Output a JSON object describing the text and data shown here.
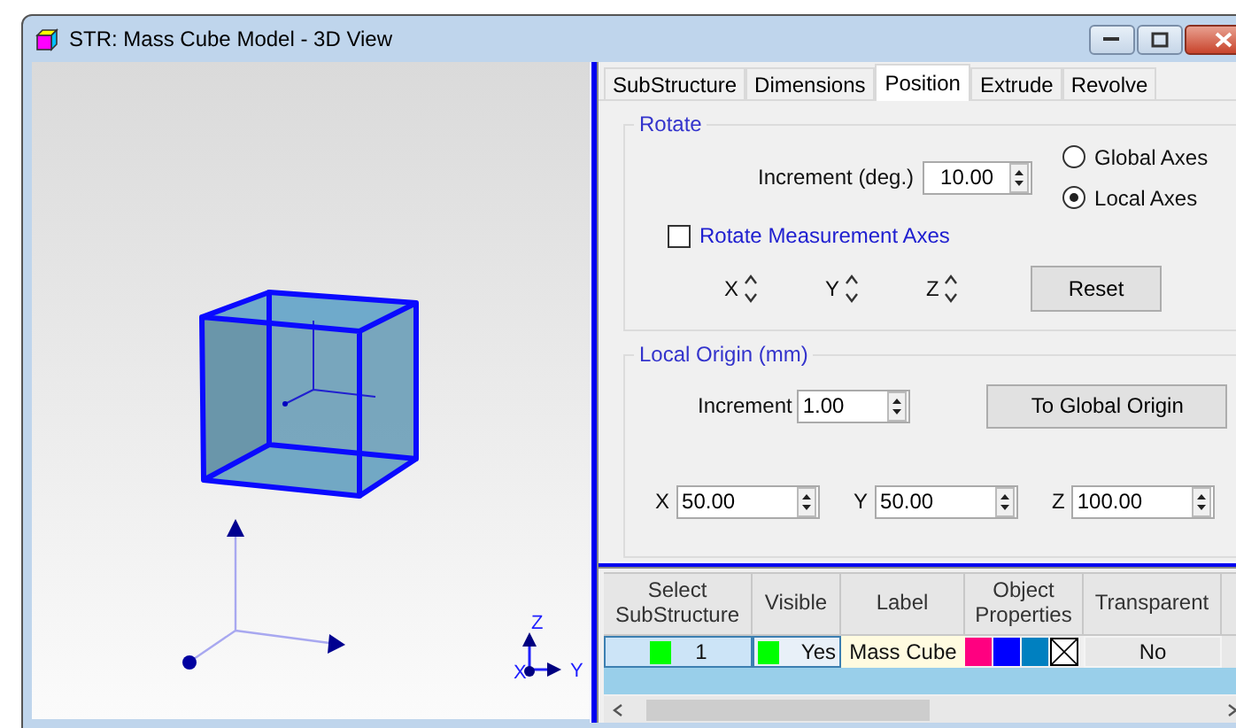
{
  "window": {
    "title": "STR: Mass Cube Model - 3D View"
  },
  "view": {
    "triad_labels": [
      "Z",
      "X",
      "Y"
    ]
  },
  "tabs": [
    {
      "label": "SubStructure",
      "selected": false
    },
    {
      "label": "Dimensions",
      "selected": false
    },
    {
      "label": "Position",
      "selected": true
    },
    {
      "label": "Extrude",
      "selected": false
    },
    {
      "label": "Revolve",
      "selected": false
    }
  ],
  "rotate": {
    "title": "Rotate",
    "increment_label": "Increment (deg.)",
    "increment": "10.00",
    "axes": [
      {
        "label": "Global Axes",
        "selected": false
      },
      {
        "label": "Local Axes",
        "selected": true
      }
    ],
    "measure": {
      "label": "Rotate Measurement Axes",
      "checked": false
    },
    "spinners": [
      "X",
      "Y",
      "Z"
    ],
    "reset": "Reset"
  },
  "origin": {
    "title": "Local Origin (mm)",
    "increment_label": "Increment",
    "increment": "1.00",
    "button": "To Global Origin",
    "coords": [
      {
        "label": "X",
        "value": "50.00"
      },
      {
        "label": "Y",
        "value": "50.00"
      },
      {
        "label": "Z",
        "value": "100.00"
      }
    ]
  },
  "table": {
    "columns": [
      "Select SubStructure",
      "Visible",
      "Label",
      "Object Properties",
      "Transparent"
    ],
    "rows": [
      {
        "select": {
          "value": "1",
          "color": "#00ff00",
          "selected": true
        },
        "visible": {
          "value": "Yes",
          "color": "#00ff00"
        },
        "label": "Mass Cube",
        "properties": [
          {
            "kind": "color",
            "color": "#ff0080"
          },
          {
            "kind": "color",
            "color": "#0000ff"
          },
          {
            "kind": "color",
            "color": "#0080c0"
          },
          {
            "kind": "none"
          }
        ],
        "transparent": "No"
      }
    ]
  }
}
